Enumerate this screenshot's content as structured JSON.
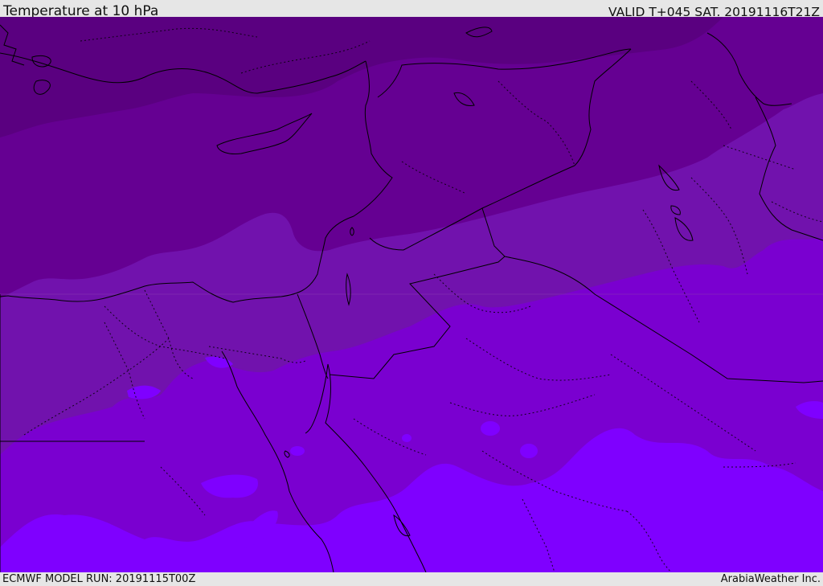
{
  "header": {
    "title": "Temperature at 10 hPa",
    "valid_time": "VALID T+045 SAT. 20191116T21Z"
  },
  "footer": {
    "model_run": "ECMWF MODEL RUN: 20191115T00Z",
    "credit": "ArabiaWeather Inc."
  },
  "map": {
    "shading_colors": [
      "#5a0080",
      "#650092",
      "#7112ad",
      "#7a00d0",
      "#7f00ff"
    ],
    "outline_color": "#000000"
  }
}
